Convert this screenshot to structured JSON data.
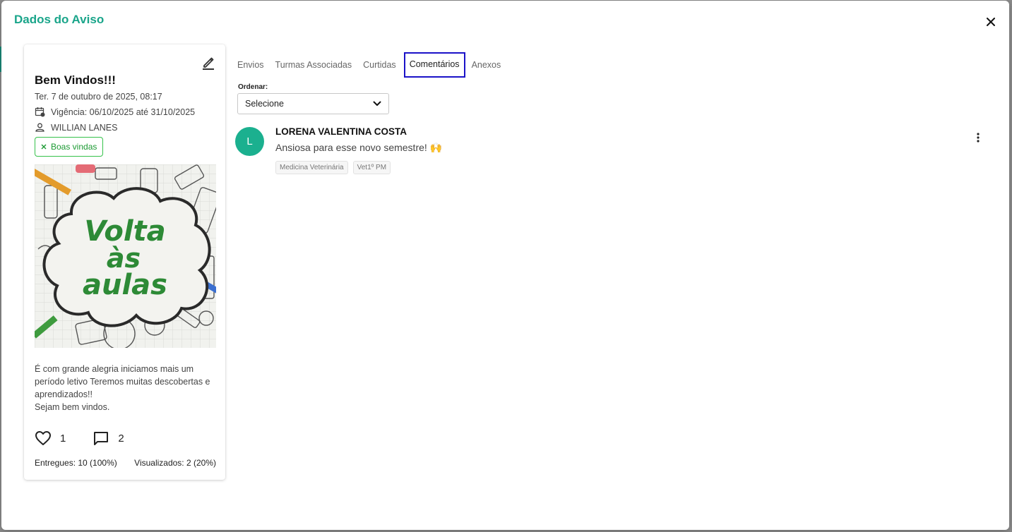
{
  "modal": {
    "title": "Dados do Aviso",
    "close_label": "×"
  },
  "card": {
    "title": "Bem Vindos!!!",
    "date": "Ter. 7 de outubro de 2025, 08:17",
    "vigencia": "Vigência: 06/10/2025 até 31/10/2025",
    "author": "WILLIAN LANES",
    "tag": "Boas vindas",
    "image_text": [
      "Volta",
      "às",
      "aulas"
    ],
    "body_lines": [
      "É com grande alegria iniciamos mais um",
      "período letivo Teremos muitas descobertas e",
      "aprendizados!!",
      "Sejam bem vindos."
    ],
    "likes": "1",
    "comments": "2",
    "delivered": "Entregues: 10 (100%)",
    "viewed": "Visualizados: 2 (20%)"
  },
  "tabs": [
    {
      "label": "Envios"
    },
    {
      "label": "Turmas Associadas"
    },
    {
      "label": "Curtidas"
    },
    {
      "label": "Comentários"
    },
    {
      "label": "Anexos"
    }
  ],
  "order": {
    "label": "Ordenar:",
    "selected": "Selecione"
  },
  "comment": {
    "avatar_letter": "L",
    "author": "LORENA VALENTINA COSTA",
    "text": "Ansiosa para esse novo semestre! 🙌",
    "tags": [
      "Medicina Veterinária",
      "Vet1º PM"
    ]
  },
  "colors": {
    "brand": "#1aa58a",
    "tag_green": "#35c24a",
    "active_tab_border": "#1b12c8",
    "avatar": "#1bb08f"
  },
  "icons": [
    "close-icon",
    "edit-icon",
    "calendar-icon",
    "user-icon",
    "x-icon",
    "heart-icon",
    "comment-icon",
    "chevron-down-icon",
    "more-vertical-icon"
  ]
}
